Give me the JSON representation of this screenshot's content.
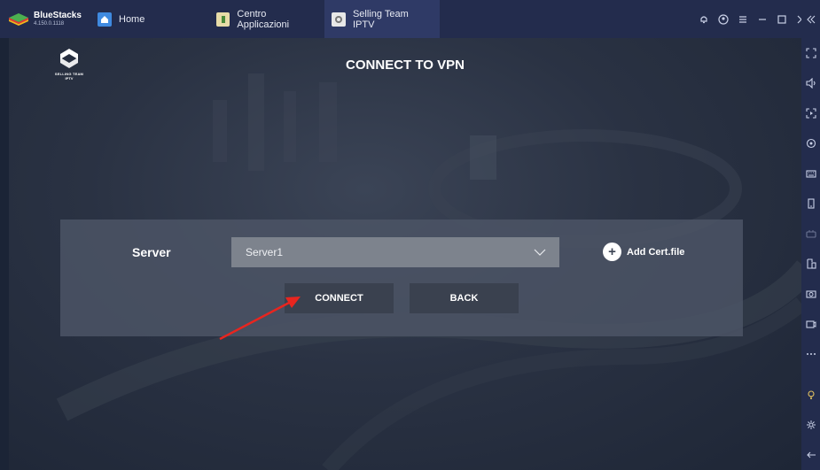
{
  "window": {
    "brand_name": "BlueStacks",
    "brand_version": "4.150.0.1118",
    "tabs": [
      {
        "label": "Home"
      },
      {
        "label": "Centro Applicazioni"
      },
      {
        "label": "Selling Team IPTV"
      }
    ]
  },
  "app": {
    "logo_line1": "SELLING TEAM",
    "logo_line2": "IPTV",
    "title": "CONNECT TO VPN",
    "server_label": "Server",
    "server_value": "Server1",
    "add_cert_label": "Add Cert.file",
    "connect_label": "CONNECT",
    "back_label": "BACK"
  },
  "annotation": {
    "arrow_color": "#e8251f"
  },
  "colors": {
    "titlebar": "#232c4d",
    "active_tab": "#2f3a66",
    "select_bg": "#7d838d"
  }
}
